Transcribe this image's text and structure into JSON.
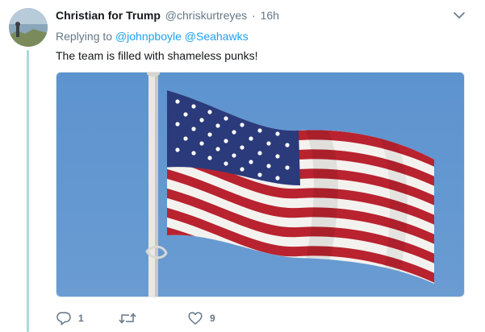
{
  "tweet": {
    "display_name": "Christian for Trump",
    "handle": "@chriskurtreyes",
    "separator": "·",
    "time": "16h",
    "replying_prefix": "Replying to",
    "replying_to": [
      "@johnpboyle",
      "@Seahawks"
    ],
    "text": "The team is filled with shameless punks!",
    "media": {
      "description_icon": "american-flag-photo"
    },
    "actions": {
      "reply_count": "1",
      "retweet_count": "",
      "like_count": "9"
    }
  },
  "colors": {
    "link": "#1da1f2",
    "muted": "#657786",
    "thread_line": "#a8dadb",
    "sky": "#5b8fc9",
    "flag_red": "#b22234",
    "flag_blue": "#2a3a78"
  },
  "icons": [
    "avatar-photo",
    "chevron-down-icon",
    "reply-icon",
    "retweet-icon",
    "like-icon"
  ]
}
